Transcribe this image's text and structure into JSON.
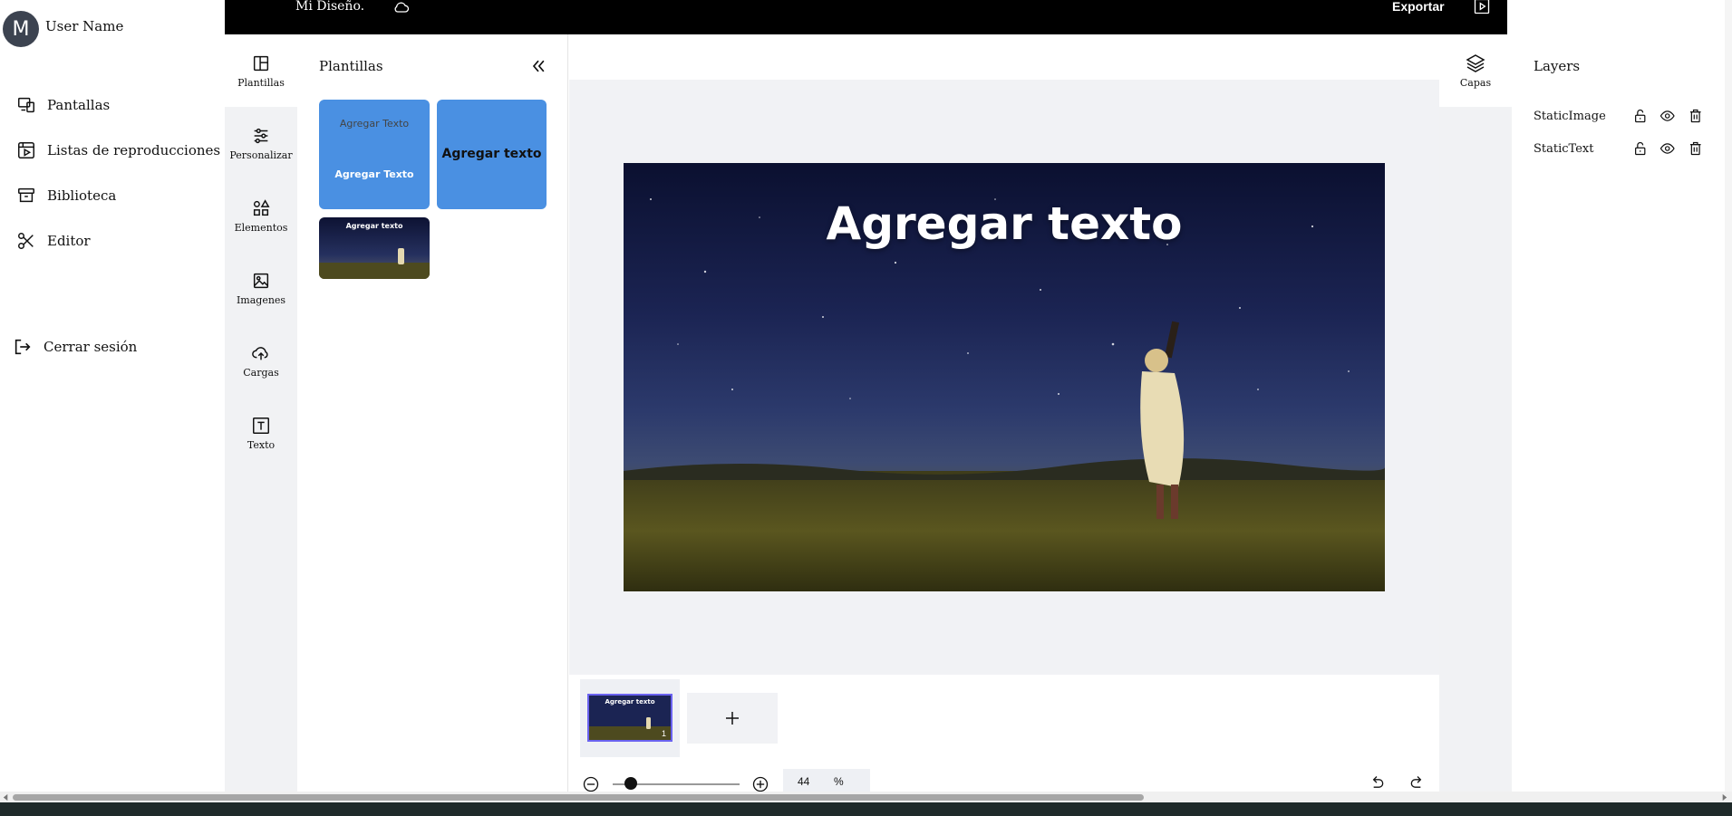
{
  "user": {
    "initial": "M",
    "name": "User Name"
  },
  "nav": {
    "items": [
      {
        "label": "Pantallas",
        "icon": "screens-icon"
      },
      {
        "label": "Listas de reproducciones",
        "icon": "playlist-icon"
      },
      {
        "label": "Biblioteca",
        "icon": "archive-icon"
      },
      {
        "label": "Editor",
        "icon": "scissors-icon"
      }
    ],
    "logout": {
      "label": "Cerrar sesión",
      "icon": "logout-icon"
    }
  },
  "topbar": {
    "design_title": "Mi Diseño.",
    "export_label": "Exportar"
  },
  "tools": [
    {
      "label": "Plantillas",
      "icon": "layout-icon"
    },
    {
      "label": "Personalizar",
      "icon": "sliders-icon"
    },
    {
      "label": "Elementos",
      "icon": "shapes-icon"
    },
    {
      "label": "Imagenes",
      "icon": "image-icon"
    },
    {
      "label": "Cargas",
      "icon": "upload-cloud-icon"
    },
    {
      "label": "Texto",
      "icon": "text-icon"
    }
  ],
  "panel": {
    "title": "Plantillas",
    "templates": [
      {
        "line1": "Agregar Texto",
        "line2": "Agregar Texto"
      },
      {
        "line1": "Agregar texto"
      },
      {
        "line1": "Agregar texto"
      }
    ]
  },
  "canvas": {
    "heading": "Agregar texto"
  },
  "pages": {
    "thumb_label": "Agregar texto",
    "page_number": "1"
  },
  "zoom": {
    "value": "44",
    "unit": "%",
    "level_percent": 44
  },
  "layers": {
    "tab_label": "Capas",
    "title": "Layers",
    "items": [
      {
        "name": "StaticImage"
      },
      {
        "name": "StaticText"
      }
    ]
  },
  "colors": {
    "accent": "#4a90e2",
    "page_border": "#6b63f0",
    "topbar": "#000000"
  }
}
